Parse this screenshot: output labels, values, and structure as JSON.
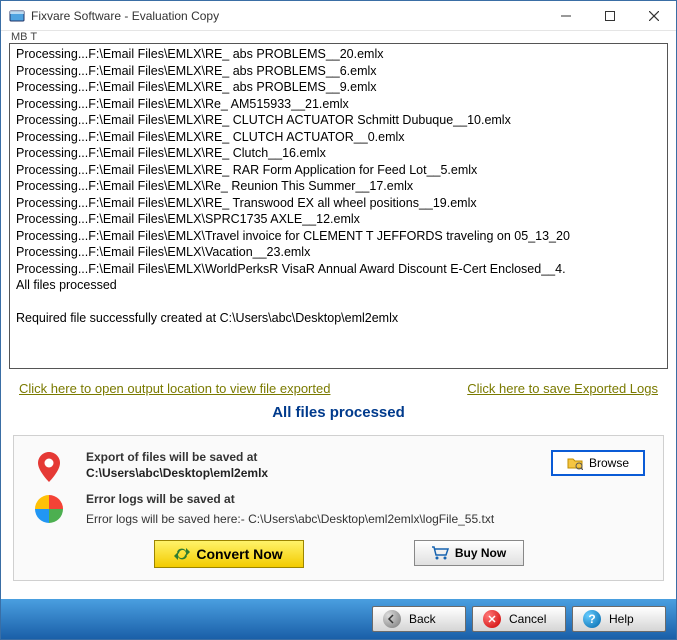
{
  "window": {
    "title": "Fixvare Software - Evaluation Copy"
  },
  "menubar": "MB    T",
  "log_lines": [
    "Processing...F:\\Email Files\\EMLX\\RE_ abs PROBLEMS__20.emlx",
    "Processing...F:\\Email Files\\EMLX\\RE_ abs PROBLEMS__6.emlx",
    "Processing...F:\\Email Files\\EMLX\\RE_ abs PROBLEMS__9.emlx",
    "Processing...F:\\Email Files\\EMLX\\Re_ AM515933__21.emlx",
    "Processing...F:\\Email Files\\EMLX\\RE_ CLUTCH ACTUATOR Schmitt Dubuque__10.emlx",
    "Processing...F:\\Email Files\\EMLX\\RE_ CLUTCH ACTUATOR__0.emlx",
    "Processing...F:\\Email Files\\EMLX\\RE_ Clutch__16.emlx",
    "Processing...F:\\Email Files\\EMLX\\RE_ RAR Form Application for Feed Lot__5.emlx",
    "Processing...F:\\Email Files\\EMLX\\Re_ Reunion This Summer__17.emlx",
    "Processing...F:\\Email Files\\EMLX\\RE_ Transwood EX all wheel positions__19.emlx",
    "Processing...F:\\Email Files\\EMLX\\SPRC1735 AXLE__12.emlx",
    "Processing...F:\\Email Files\\EMLX\\Travel invoice for CLEMENT T JEFFORDS traveling on 05_13_20",
    "Processing...F:\\Email Files\\EMLX\\Vacation__23.emlx",
    "Processing...F:\\Email Files\\EMLX\\WorldPerksR VisaR Annual Award Discount E-Cert Enclosed__4.",
    "All files processed",
    "",
    "Required file successfully created at C:\\Users\\abc\\Desktop\\eml2emlx"
  ],
  "links": {
    "open_output": "Click here to open output location to view file exported",
    "save_logs": "Click here to save Exported Logs"
  },
  "status": "All files processed",
  "options": {
    "export_label": "Export of files will be saved at",
    "export_path": "C:\\Users\\abc\\Desktop\\eml2emlx",
    "browse": "Browse",
    "error_label": "Error logs will be saved at",
    "error_path": "Error logs will be saved here:- C:\\Users\\abc\\Desktop\\eml2emlx\\logFile_55.txt"
  },
  "actions": {
    "convert": "Convert Now",
    "buy": "Buy Now"
  },
  "nav": {
    "back": "Back",
    "cancel": "Cancel",
    "help": "Help"
  }
}
